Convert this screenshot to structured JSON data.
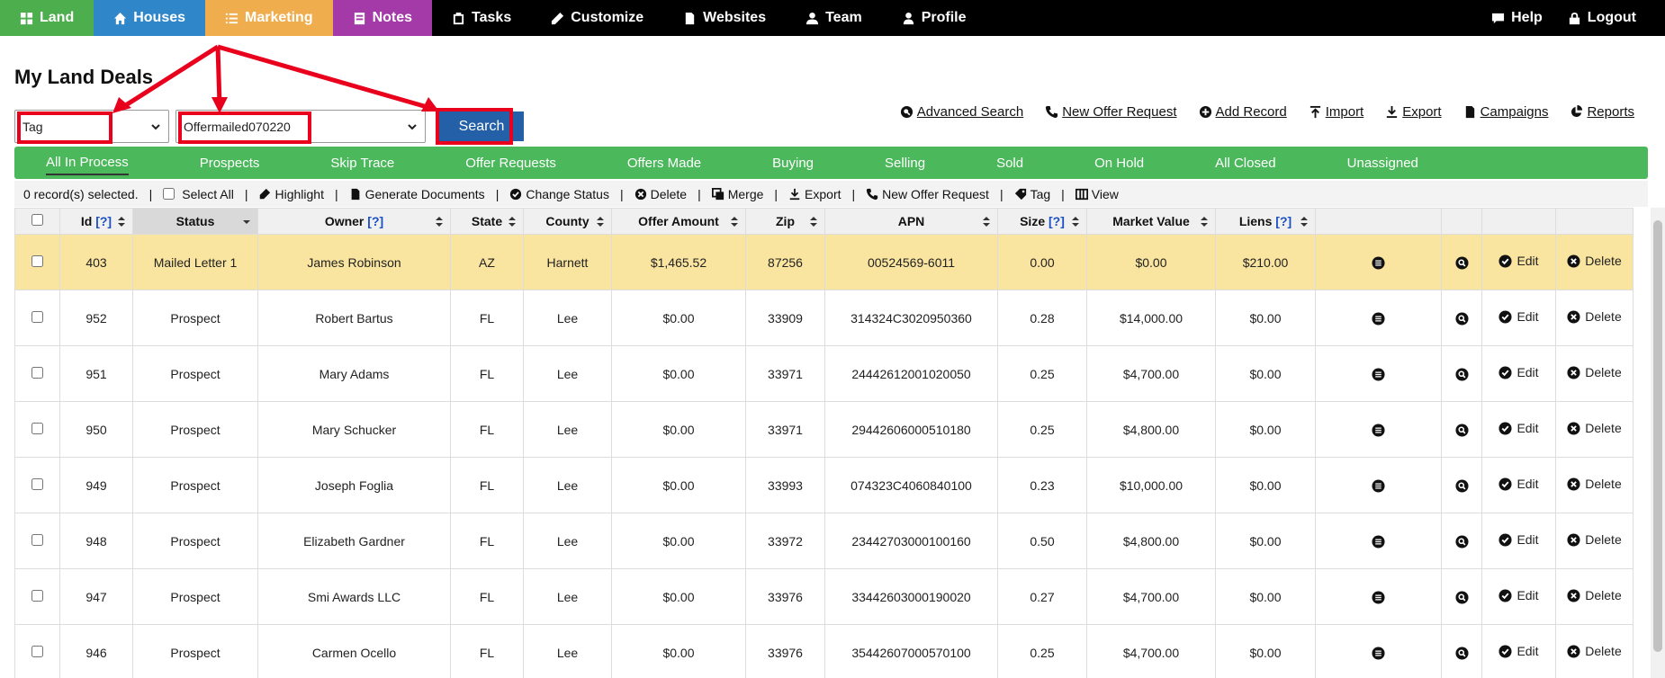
{
  "nav": {
    "items": [
      {
        "label": "Land",
        "bg": "#4cae4c",
        "icon": "grid-icon"
      },
      {
        "label": "Houses",
        "bg": "#2f86c9",
        "icon": "home-icon"
      },
      {
        "label": "Marketing",
        "bg": "#f0ad4e",
        "icon": "list-icon"
      },
      {
        "label": "Notes",
        "bg": "#a43aa8",
        "icon": "notes-icon"
      },
      {
        "label": "Tasks",
        "bg": "#000000",
        "icon": "clipboard-icon"
      },
      {
        "label": "Customize",
        "bg": "#000000",
        "icon": "pencil-icon"
      },
      {
        "label": "Websites",
        "bg": "#000000",
        "icon": "file-icon"
      },
      {
        "label": "Team",
        "bg": "#000000",
        "icon": "team-icon"
      },
      {
        "label": "Profile",
        "bg": "#000000",
        "icon": "user-icon"
      }
    ],
    "right": [
      {
        "label": "Help",
        "icon": "chat-icon"
      },
      {
        "label": "Logout",
        "icon": "lock-icon"
      }
    ]
  },
  "page": {
    "title": "My Land Deals"
  },
  "search": {
    "field_value": "Tag",
    "filter_value": "Offermailed070220",
    "button_label": "Search"
  },
  "actions": [
    {
      "label": "Advanced Search",
      "icon": "search-icon"
    },
    {
      "label": "New Offer Request",
      "icon": "phone-icon"
    },
    {
      "label": "Add Record",
      "icon": "plus-circle-icon"
    },
    {
      "label": "Import",
      "icon": "upload-icon"
    },
    {
      "label": "Export",
      "icon": "download-icon"
    },
    {
      "label": "Campaigns",
      "icon": "file-icon"
    },
    {
      "label": "Reports",
      "icon": "pie-chart-icon"
    }
  ],
  "tabs": [
    "All In Process",
    "Prospects",
    "Skip Trace",
    "Offer Requests",
    "Offers Made",
    "Buying",
    "Selling",
    "Sold",
    "On Hold",
    "All Closed",
    "Unassigned"
  ],
  "active_tab": "All In Process",
  "bulk": {
    "selected_text": "0 record(s) selected.",
    "select_all": "Select All",
    "highlight": "Highlight",
    "generate": "Generate Documents",
    "change_status": "Change Status",
    "delete": "Delete",
    "merge": "Merge",
    "export": "Export",
    "new_offer": "New Offer Request",
    "tag": "Tag",
    "view": "View"
  },
  "table": {
    "headers": [
      {
        "label": "Id",
        "help": "[?]"
      },
      {
        "label": "Status",
        "help": ""
      },
      {
        "label": "Owner",
        "help": "[?]"
      },
      {
        "label": "State",
        "help": ""
      },
      {
        "label": "County",
        "help": ""
      },
      {
        "label": "Offer Amount",
        "help": ""
      },
      {
        "label": "Zip",
        "help": ""
      },
      {
        "label": "APN",
        "help": ""
      },
      {
        "label": "Size",
        "help": "[?]"
      },
      {
        "label": "Market Value",
        "help": ""
      },
      {
        "label": "Liens",
        "help": "[?]"
      }
    ],
    "edit_label": "Edit",
    "delete_label": "Delete",
    "rows": [
      {
        "id": "403",
        "status": "Mailed Letter 1",
        "owner": "James Robinson",
        "state": "AZ",
        "county": "Harnett",
        "offer": "$1,465.52",
        "zip": "87256",
        "apn": "00524569-6011",
        "size": "0.00",
        "market": "$0.00",
        "liens": "$210.00"
      },
      {
        "id": "952",
        "status": "Prospect",
        "owner": "Robert Bartus",
        "state": "FL",
        "county": "Lee",
        "offer": "$0.00",
        "zip": "33909",
        "apn": "314324C3020950360",
        "size": "0.28",
        "market": "$14,000.00",
        "liens": "$0.00"
      },
      {
        "id": "951",
        "status": "Prospect",
        "owner": "Mary Adams",
        "state": "FL",
        "county": "Lee",
        "offer": "$0.00",
        "zip": "33971",
        "apn": "24442612001020050",
        "size": "0.25",
        "market": "$4,700.00",
        "liens": "$0.00"
      },
      {
        "id": "950",
        "status": "Prospect",
        "owner": "Mary Schucker",
        "state": "FL",
        "county": "Lee",
        "offer": "$0.00",
        "zip": "33971",
        "apn": "29442606000510180",
        "size": "0.25",
        "market": "$4,800.00",
        "liens": "$0.00"
      },
      {
        "id": "949",
        "status": "Prospect",
        "owner": "Joseph Foglia",
        "state": "FL",
        "county": "Lee",
        "offer": "$0.00",
        "zip": "33993",
        "apn": "074323C4060840100",
        "size": "0.23",
        "market": "$10,000.00",
        "liens": "$0.00"
      },
      {
        "id": "948",
        "status": "Prospect",
        "owner": "Elizabeth Gardner",
        "state": "FL",
        "county": "Lee",
        "offer": "$0.00",
        "zip": "33972",
        "apn": "23442703000100160",
        "size": "0.50",
        "market": "$4,800.00",
        "liens": "$0.00"
      },
      {
        "id": "947",
        "status": "Prospect",
        "owner": "Smi Awards LLC",
        "state": "FL",
        "county": "Lee",
        "offer": "$0.00",
        "zip": "33976",
        "apn": "33442603000190020",
        "size": "0.27",
        "market": "$4,700.00",
        "liens": "$0.00"
      },
      {
        "id": "946",
        "status": "Prospect",
        "owner": "Carmen Ocello",
        "state": "FL",
        "county": "Lee",
        "offer": "$0.00",
        "zip": "33976",
        "apn": "35442607000570100",
        "size": "0.25",
        "market": "$4,700.00",
        "liens": "$0.00"
      }
    ]
  },
  "colors": {
    "highlight_row": "#f9e59f",
    "tabs_bg": "#4bb85b",
    "search_btn": "#2360a8",
    "annotation": "#e8001c"
  }
}
